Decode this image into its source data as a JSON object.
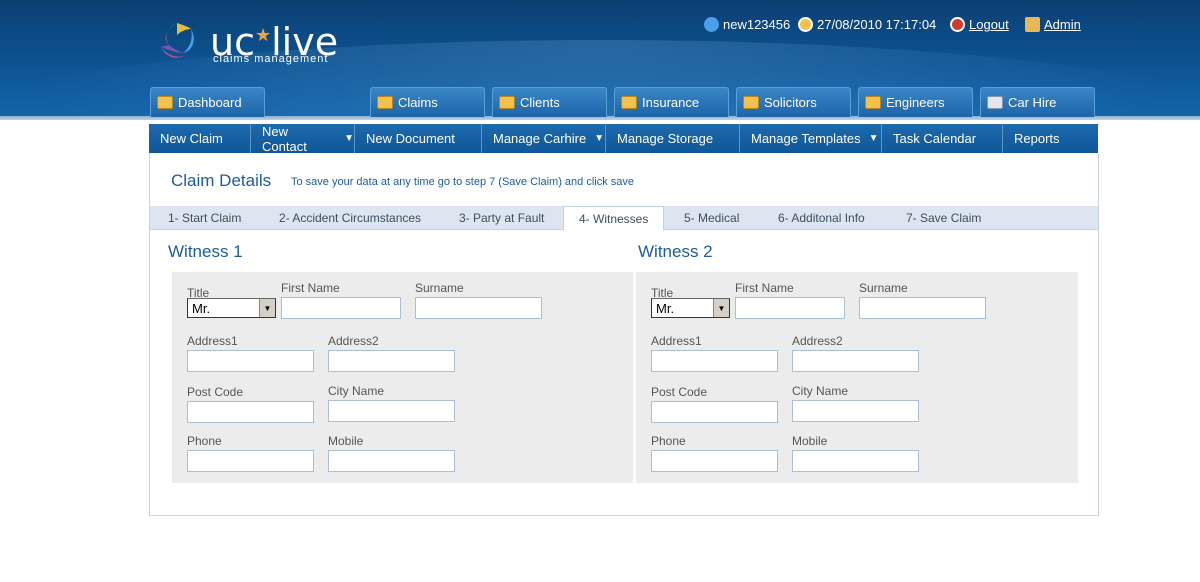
{
  "brand": {
    "name_left": "uc",
    "name_right": "live",
    "tagline": "claims management"
  },
  "userbar": {
    "username": "new123456",
    "datetime": "27/08/2010 17:17:04",
    "logout": "Logout",
    "admin": "Admin"
  },
  "main_tabs": [
    {
      "label": "Dashboard",
      "icon": "dashboard-icon"
    },
    {
      "label": "Claims",
      "icon": "folder-icon"
    },
    {
      "label": "Clients",
      "icon": "clients-icon"
    },
    {
      "label": "Insurance",
      "icon": "insurance-icon"
    },
    {
      "label": "Solicitors",
      "icon": "solicitors-icon"
    },
    {
      "label": "Engineers",
      "icon": "engineers-icon"
    },
    {
      "label": "Car Hire",
      "icon": "car-icon"
    }
  ],
  "sub_nav": [
    {
      "label": "New Claim"
    },
    {
      "label": "New Contact",
      "dropdown": "▼"
    },
    {
      "label": "New Document"
    },
    {
      "label": "Manage Carhire",
      "dropdown": "▼"
    },
    {
      "label": "Manage Storage"
    },
    {
      "label": "Manage Templates",
      "dropdown": "▼"
    },
    {
      "label": "Task Calendar"
    },
    {
      "label": "Reports"
    }
  ],
  "page": {
    "title": "Claim Details",
    "note": "To save your data at any time go to step 7 (Save Claim) and click save"
  },
  "steps": [
    {
      "label": "1- Start Claim"
    },
    {
      "label": "2- Accident Circumstances"
    },
    {
      "label": "3- Party at Fault"
    },
    {
      "label": "4- Witnesses",
      "active": true
    },
    {
      "label": "5- Medical"
    },
    {
      "label": "6- Additonal Info"
    },
    {
      "label": "7- Save Claim"
    }
  ],
  "witnesses": [
    {
      "heading": "Witness 1",
      "title_label": "Title",
      "title_value": "Mr.",
      "first_name_label": "First Name",
      "first_name_value": "",
      "surname_label": "Surname",
      "surname_value": "",
      "address1_label": "Address1",
      "address1_value": "",
      "address2_label": "Address2",
      "address2_value": "",
      "postcode_label": "Post Code",
      "postcode_value": "",
      "city_label": "City Name",
      "city_value": "",
      "phone_label": "Phone",
      "phone_value": "",
      "mobile_label": "Mobile",
      "mobile_value": ""
    },
    {
      "heading": "Witness 2",
      "title_label": "Title",
      "title_value": "Mr.",
      "first_name_label": "First Name",
      "first_name_value": "",
      "surname_label": "Surname",
      "surname_value": "",
      "address1_label": "Address1",
      "address1_value": "",
      "address2_label": "Address2",
      "address2_value": "",
      "postcode_label": "Post Code",
      "postcode_value": "",
      "city_label": "City Name",
      "city_value": "",
      "phone_label": "Phone",
      "phone_value": "",
      "mobile_label": "Mobile",
      "mobile_value": ""
    }
  ],
  "colors": {
    "header": "#0d5494",
    "accent": "#1b5d9a",
    "panel": "#ececec"
  }
}
